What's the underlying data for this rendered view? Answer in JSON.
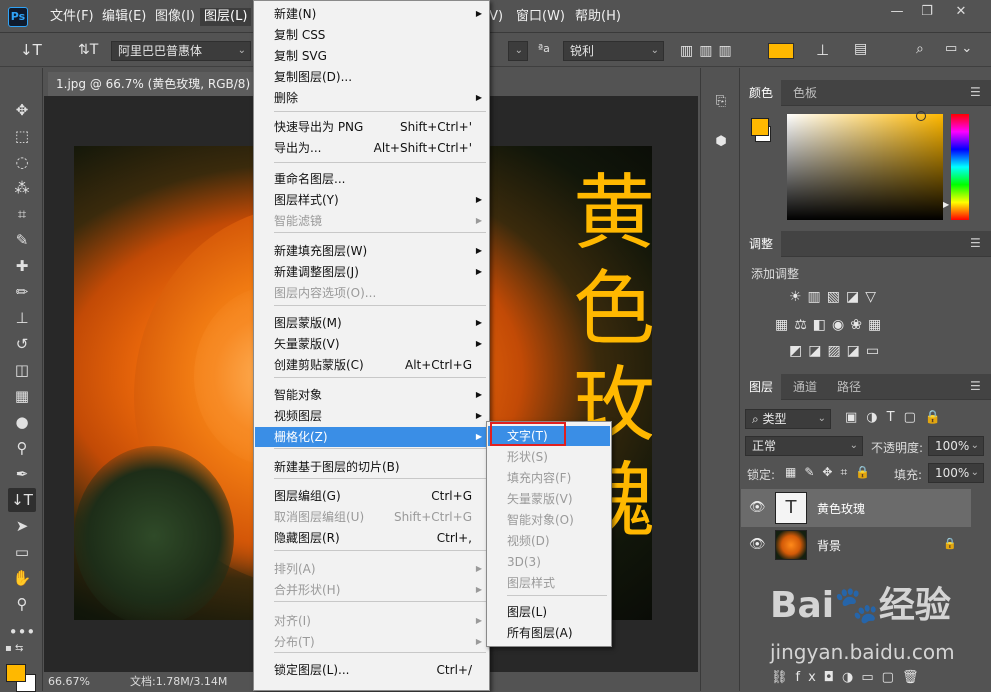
{
  "app": {
    "logo": "Ps"
  },
  "menubar": {
    "items": [
      "文件(F)",
      "编辑(E)",
      "图像(I)",
      "图层(L)",
      "(V)",
      "窗口(W)",
      "帮助(H)"
    ]
  },
  "options": {
    "font_family": "阿里巴巴普惠体",
    "antialias_label": "ªa",
    "antialias": "锐利",
    "color_swatch": "#ffb800"
  },
  "document": {
    "tab_title": "1.jpg @ 66.7% (黄色玫瑰, RGB/8) *",
    "vertical_text": [
      "黄",
      "色",
      "玫",
      "瑰"
    ],
    "zoom": "66.67%",
    "doc_size": "文档:1.78M/3.14M"
  },
  "colors": {
    "foreground": "#ffb800",
    "background": "#ffffff",
    "accent": "#3a8ee6"
  },
  "layer_menu": {
    "items": [
      {
        "label": "新建(N)",
        "shortcut": "",
        "submenu": true,
        "disabled": false
      },
      {
        "label": "复制 CSS",
        "shortcut": "",
        "submenu": false,
        "disabled": false
      },
      {
        "label": "复制 SVG",
        "shortcut": "",
        "submenu": false,
        "disabled": false
      },
      {
        "label": "复制图层(D)...",
        "shortcut": "",
        "submenu": false,
        "disabled": false
      },
      {
        "label": "删除",
        "shortcut": "",
        "submenu": true,
        "disabled": false
      },
      {
        "label": "快速导出为 PNG",
        "shortcut": "Shift+Ctrl+'",
        "submenu": false,
        "disabled": false
      },
      {
        "label": "导出为...",
        "shortcut": "Alt+Shift+Ctrl+'",
        "submenu": false,
        "disabled": false
      },
      {
        "label": "重命名图层...",
        "shortcut": "",
        "submenu": false,
        "disabled": false
      },
      {
        "label": "图层样式(Y)",
        "shortcut": "",
        "submenu": true,
        "disabled": false
      },
      {
        "label": "智能滤镜",
        "shortcut": "",
        "submenu": true,
        "disabled": true
      },
      {
        "label": "新建填充图层(W)",
        "shortcut": "",
        "submenu": true,
        "disabled": false
      },
      {
        "label": "新建调整图层(J)",
        "shortcut": "",
        "submenu": true,
        "disabled": false
      },
      {
        "label": "图层内容选项(O)...",
        "shortcut": "",
        "submenu": false,
        "disabled": true
      },
      {
        "label": "图层蒙版(M)",
        "shortcut": "",
        "submenu": true,
        "disabled": false
      },
      {
        "label": "矢量蒙版(V)",
        "shortcut": "",
        "submenu": true,
        "disabled": false
      },
      {
        "label": "创建剪贴蒙版(C)",
        "shortcut": "Alt+Ctrl+G",
        "submenu": false,
        "disabled": false
      },
      {
        "label": "智能对象",
        "shortcut": "",
        "submenu": true,
        "disabled": false
      },
      {
        "label": "视频图层",
        "shortcut": "",
        "submenu": true,
        "disabled": false
      },
      {
        "label": "栅格化(Z)",
        "shortcut": "",
        "submenu": true,
        "disabled": false,
        "highlighted": true
      },
      {
        "label": "新建基于图层的切片(B)",
        "shortcut": "",
        "submenu": false,
        "disabled": false
      },
      {
        "label": "图层编组(G)",
        "shortcut": "Ctrl+G",
        "submenu": false,
        "disabled": false
      },
      {
        "label": "取消图层编组(U)",
        "shortcut": "Shift+Ctrl+G",
        "submenu": false,
        "disabled": true
      },
      {
        "label": "隐藏图层(R)",
        "shortcut": "Ctrl+,",
        "submenu": false,
        "disabled": false
      },
      {
        "label": "排列(A)",
        "shortcut": "",
        "submenu": true,
        "disabled": true
      },
      {
        "label": "合并形状(H)",
        "shortcut": "",
        "submenu": true,
        "disabled": true
      },
      {
        "label": "对齐(I)",
        "shortcut": "",
        "submenu": true,
        "disabled": true
      },
      {
        "label": "分布(T)",
        "shortcut": "",
        "submenu": true,
        "disabled": true
      },
      {
        "label": "锁定图层(L)...",
        "shortcut": "Ctrl+/",
        "submenu": false,
        "disabled": false
      }
    ]
  },
  "rasterize_submenu": {
    "items": [
      {
        "label": "文字(T)",
        "disabled": false,
        "highlighted": true
      },
      {
        "label": "形状(S)",
        "disabled": true
      },
      {
        "label": "填充内容(F)",
        "disabled": true
      },
      {
        "label": "矢量蒙版(V)",
        "disabled": true
      },
      {
        "label": "智能对象(O)",
        "disabled": true
      },
      {
        "label": "视频(D)",
        "disabled": true
      },
      {
        "label": "3D(3)",
        "disabled": true
      },
      {
        "label": "图层样式",
        "disabled": true
      },
      {
        "label": "图层(L)",
        "disabled": false
      },
      {
        "label": "所有图层(A)",
        "disabled": false
      }
    ]
  },
  "color_panel": {
    "tabs": [
      "颜色",
      "色板"
    ]
  },
  "adjust_panel": {
    "title": "调整",
    "add_label": "添加调整"
  },
  "layers_panel": {
    "tabs": [
      "图层",
      "通道",
      "路径"
    ],
    "filter_label": "类型",
    "blend_mode": "正常",
    "opacity_label": "不透明度:",
    "opacity": "100%",
    "lock_label": "锁定:",
    "fill_label": "填充:",
    "fill": "100%",
    "layers": [
      {
        "name": "黄色玫瑰",
        "type": "text",
        "thumb": "T",
        "selected": true
      },
      {
        "name": "背景",
        "type": "image",
        "thumb": "",
        "selected": false
      }
    ]
  },
  "watermark": {
    "brand": "Bai",
    "brand2": "经验",
    "url": "jingyan.baidu.com"
  }
}
